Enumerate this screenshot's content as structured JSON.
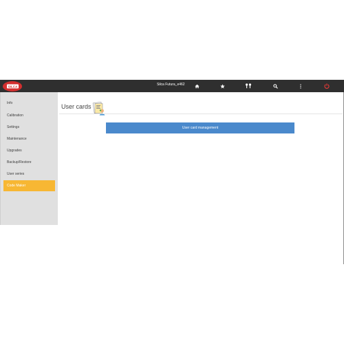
{
  "topbar": {
    "logo_text": "SILCA",
    "device_name": "Silca Futura_e462",
    "icons": [
      "home-icon",
      "star-icon",
      "keys-icon",
      "search-icon",
      "more-vertical-icon",
      "power-icon"
    ]
  },
  "sidebar": {
    "items": [
      {
        "label": "Info"
      },
      {
        "label": "Calibration"
      },
      {
        "label": "Settings"
      },
      {
        "label": "Maintenance"
      },
      {
        "label": "Upgrades"
      },
      {
        "label": "Backup/Restore"
      },
      {
        "label": "User series"
      },
      {
        "label": "Code Maker"
      }
    ],
    "active_index": 7
  },
  "main": {
    "title": "User cards",
    "title_icon": "user-cards-icon",
    "button_label": "User card management"
  },
  "colors": {
    "topbar": "#2f2f2f",
    "accent": "#f7b733",
    "button": "#4a89cc",
    "power": "#e53935",
    "logo_red": "#d32f2f"
  }
}
